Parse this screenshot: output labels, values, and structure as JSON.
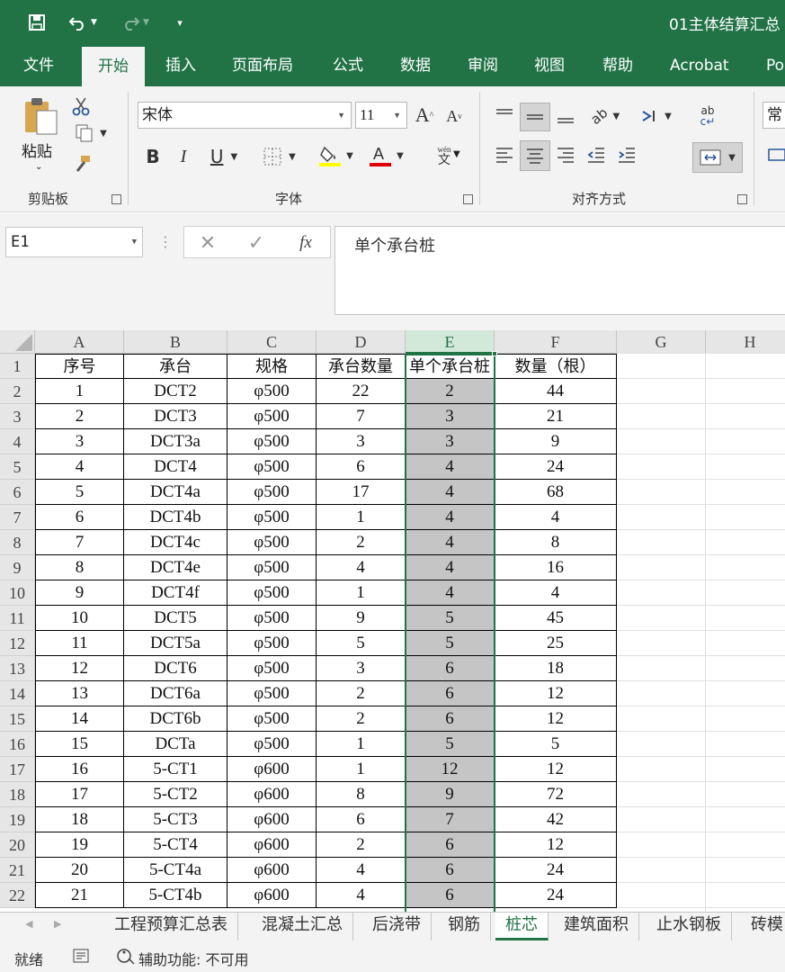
{
  "title_bar": {
    "document_title": "01主体结算汇总"
  },
  "ribbon_tabs": [
    "文件",
    "开始",
    "插入",
    "页面布局",
    "公式",
    "数据",
    "审阅",
    "视图",
    "帮助",
    "Acrobat",
    "Po"
  ],
  "ribbon": {
    "clipboard": {
      "paste_label": "粘贴",
      "group_label": "剪贴板"
    },
    "font": {
      "font_name": "宋体",
      "font_size": "11",
      "group_label": "字体",
      "phonetic_top": "wén",
      "phonetic_bottom": "文"
    },
    "alignment": {
      "group_label": "对齐方式"
    },
    "number": {
      "format_partial": "常"
    }
  },
  "formula_bar": {
    "name_box": "E1",
    "content": "单个承台桩"
  },
  "columns": [
    "A",
    "B",
    "C",
    "D",
    "E",
    "F",
    "G",
    "H"
  ],
  "row_numbers": [
    "1",
    "2",
    "3",
    "4",
    "5",
    "6",
    "7",
    "8",
    "9",
    "10",
    "11",
    "12",
    "13",
    "14",
    "15",
    "16",
    "17",
    "18",
    "19",
    "20",
    "21",
    "22"
  ],
  "table": {
    "headers": [
      "序号",
      "承台",
      "规格",
      "承台数量",
      "单个承台桩",
      "数量（根）"
    ],
    "rows": [
      [
        "1",
        "DCT2",
        "φ500",
        "22",
        "2",
        "44"
      ],
      [
        "2",
        "DCT3",
        "φ500",
        "7",
        "3",
        "21"
      ],
      [
        "3",
        "DCT3a",
        "φ500",
        "3",
        "3",
        "9"
      ],
      [
        "4",
        "DCT4",
        "φ500",
        "6",
        "4",
        "24"
      ],
      [
        "5",
        "DCT4a",
        "φ500",
        "17",
        "4",
        "68"
      ],
      [
        "6",
        "DCT4b",
        "φ500",
        "1",
        "4",
        "4"
      ],
      [
        "7",
        "DCT4c",
        "φ500",
        "2",
        "4",
        "8"
      ],
      [
        "8",
        "DCT4e",
        "φ500",
        "4",
        "4",
        "16"
      ],
      [
        "9",
        "DCT4f",
        "φ500",
        "1",
        "4",
        "4"
      ],
      [
        "10",
        "DCT5",
        "φ500",
        "9",
        "5",
        "45"
      ],
      [
        "11",
        "DCT5a",
        "φ500",
        "5",
        "5",
        "25"
      ],
      [
        "12",
        "DCT6",
        "φ500",
        "3",
        "6",
        "18"
      ],
      [
        "13",
        "DCT6a",
        "φ500",
        "2",
        "6",
        "12"
      ],
      [
        "14",
        "DCT6b",
        "φ500",
        "2",
        "6",
        "12"
      ],
      [
        "15",
        "DCTa",
        "φ500",
        "1",
        "5",
        "5"
      ],
      [
        "16",
        "5-CT1",
        "φ600",
        "1",
        "12",
        "12"
      ],
      [
        "17",
        "5-CT2",
        "φ600",
        "8",
        "9",
        "72"
      ],
      [
        "18",
        "5-CT3",
        "φ600",
        "6",
        "7",
        "42"
      ],
      [
        "19",
        "5-CT4",
        "φ600",
        "2",
        "6",
        "12"
      ],
      [
        "20",
        "5-CT4a",
        "φ600",
        "4",
        "6",
        "24"
      ],
      [
        "21",
        "5-CT4b",
        "φ600",
        "4",
        "6",
        "24"
      ]
    ]
  },
  "sheet_tabs": [
    {
      "label": "工程预算汇总表",
      "active": false
    },
    {
      "label": "混凝土汇总",
      "active": false
    },
    {
      "label": "后浇带",
      "active": false
    },
    {
      "label": "钢筋",
      "active": false
    },
    {
      "label": "桩芯",
      "active": true
    },
    {
      "label": "建筑面积",
      "active": false
    },
    {
      "label": "止水钢板",
      "active": false
    },
    {
      "label": "砖模",
      "active": false
    }
  ],
  "status_bar": {
    "ready": "就绪",
    "accessibility": "辅助功能: 不可用"
  },
  "colors": {
    "excel_green": "#217346",
    "selected_column_fill": "#c5c5c5",
    "header_fill": "#e6e6e6"
  },
  "icons": [
    "save-icon",
    "undo-icon",
    "redo-icon",
    "customize-qat-icon",
    "cut-icon",
    "copy-icon",
    "format-painter-icon",
    "bold-icon",
    "italic-icon",
    "underline-icon",
    "border-icon",
    "fill-color-icon",
    "font-color-icon",
    "increase-font-icon",
    "decrease-font-icon",
    "cancel-icon",
    "enter-icon",
    "function-icon"
  ]
}
